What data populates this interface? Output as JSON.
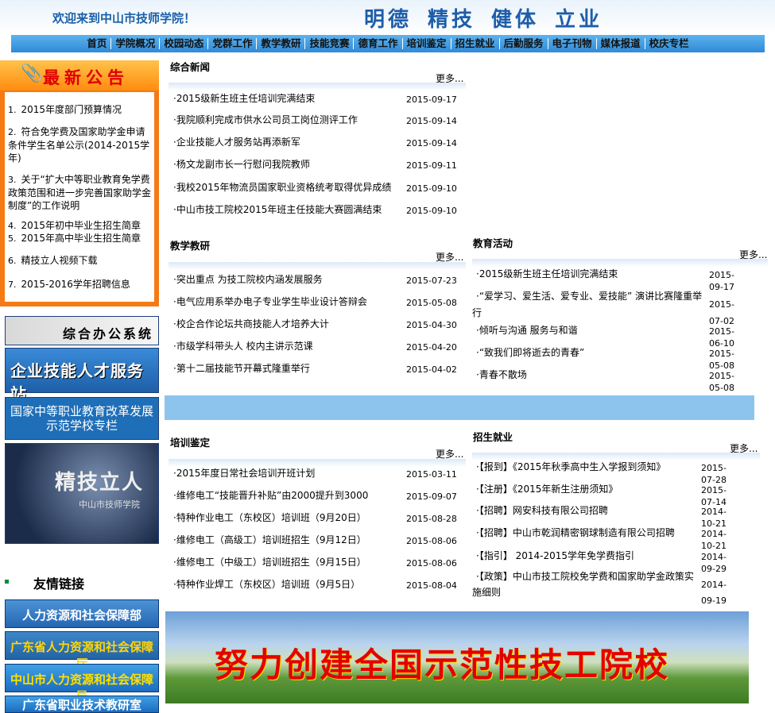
{
  "header": {
    "welcome": "欢迎来到中山市技师学院！",
    "motto": [
      "明德",
      "精技",
      "健体",
      "立业"
    ]
  },
  "nav": [
    "首页",
    "学院概况",
    "校园动态",
    "党群工作",
    "教学教研",
    "技能竞赛",
    "德育工作",
    "培训鉴定",
    "招生就业",
    "后勤服务",
    "电子刊物",
    "媒体报道",
    "校庆专栏"
  ],
  "notice": {
    "title": "最新公告",
    "items": [
      {
        "n": "1.",
        "text": "2015年度部门预算情况"
      },
      {
        "n": "2.",
        "text": "符合免学费及国家助学金申请条件学生名单公示(2014-2015学年)"
      },
      {
        "n": "3.",
        "text": "关于“扩大中等职业教育免学费政策范围和进一步完善国家助学金制度”的工作说明"
      },
      {
        "n": "4.",
        "text": "2015年初中毕业生招生简章"
      },
      {
        "n": "5.",
        "text": "2015年高中毕业生招生简章"
      },
      {
        "n": "6.",
        "text": "精技立人视频下载"
      },
      {
        "n": "7.",
        "text": "2015-2016学年招聘信息"
      }
    ]
  },
  "banners": {
    "office": "综合办公系统",
    "talent": "企业技能人才服务站",
    "reform": "国家中等职业教育改革发展示范学校专栏",
    "jingji": "精技立人",
    "jingji_sub": "中山市技师学院"
  },
  "links": {
    "title": "友情链接",
    "items": [
      "人力资源和社会保障部",
      "广东省人力资源和社会保障厅",
      "中山市人力资源和社会保障局",
      "广东省职业技术教研室"
    ]
  },
  "more": "更多...",
  "sections": {
    "general": {
      "title": "综合新闻",
      "items": [
        {
          "t": "2015级新生班主任培训完满结束",
          "d": "2015-09-17"
        },
        {
          "t": "我院顺利完成市供水公司员工岗位测评工作",
          "d": "2015-09-14"
        },
        {
          "t": "企业技能人才服务站再添新军",
          "d": "2015-09-14"
        },
        {
          "t": "杨文龙副市长一行慰问我院教师",
          "d": "2015-09-11"
        },
        {
          "t": "我校2015年物流员国家职业资格统考取得优异成绩",
          "d": "2015-09-10"
        },
        {
          "t": "中山市技工院校2015年班主任技能大赛圆满结束",
          "d": "2015-09-10"
        }
      ]
    },
    "teaching": {
      "title": "教学教研",
      "items": [
        {
          "t": "突出重点 为技工院校内涵发展服务",
          "d": "2015-07-23"
        },
        {
          "t": "电气应用系举办电子专业学生毕业设计答辩会",
          "d": "2015-05-08"
        },
        {
          "t": "校企合作论坛共商技能人才培养大计",
          "d": "2015-04-30"
        },
        {
          "t": "市级学科带头人 校内主讲示范课",
          "d": "2015-04-20"
        },
        {
          "t": "第十二届技能节开幕式隆重举行",
          "d": "2015-04-02"
        }
      ]
    },
    "education": {
      "title": "教育活动",
      "items": [
        {
          "t": "2015级新生班主任培训完满结束",
          "d": "2015-09-17"
        },
        {
          "t": "“爱学习、爱生活、爱专业、爱技能” 演讲比赛隆重举行",
          "d": "2015-07-02"
        },
        {
          "t": "倾听与沟通 服务与和谐",
          "d": "2015-06-10"
        },
        {
          "t": "“致我们即将逝去的青春”",
          "d": "2015-05-08"
        },
        {
          "t": "青春不散场",
          "d": "2015-05-08"
        }
      ]
    },
    "training": {
      "title": "培训鉴定",
      "items": [
        {
          "t": "2015年度日常社会培训开班计划",
          "d": "2015-03-11"
        },
        {
          "t": "维修电工“技能晋升补贴”由2000提升到3000",
          "d": "2015-09-07"
        },
        {
          "t": "特种作业电工（东校区）培训班（9月20日）",
          "d": "2015-08-28"
        },
        {
          "t": "维修电工（高级工）培训班招生（9月12日）",
          "d": "2015-08-06"
        },
        {
          "t": "维修电工（中级工）培训班招生（9月15日）",
          "d": "2015-08-06"
        },
        {
          "t": "特种作业焊工（东校区）培训班（9月5日）",
          "d": "2015-08-04"
        }
      ]
    },
    "enroll": {
      "title": "招生就业",
      "items": [
        {
          "t": "【报到】《2015年秋季高中生入学报到须知》",
          "d": "2015-07-28"
        },
        {
          "t": "【注册】《2015年新生注册须知》",
          "d": "2015-07-14"
        },
        {
          "t": "【招聘】网安科技有限公司招聘",
          "d": "2014-10-21"
        },
        {
          "t": "【招聘】中山市乾润精密钢球制造有限公司招聘",
          "d": "2014-10-21"
        },
        {
          "t": "【指引】 2014-2015学年免学费指引",
          "d": "2014-09-29"
        },
        {
          "t": "【政策】中山市技工院校免学费和国家助学金政策实施细则",
          "d": "2014-09-19"
        }
      ]
    }
  },
  "bottom_banner": "努力创建全国示范性技工院校"
}
